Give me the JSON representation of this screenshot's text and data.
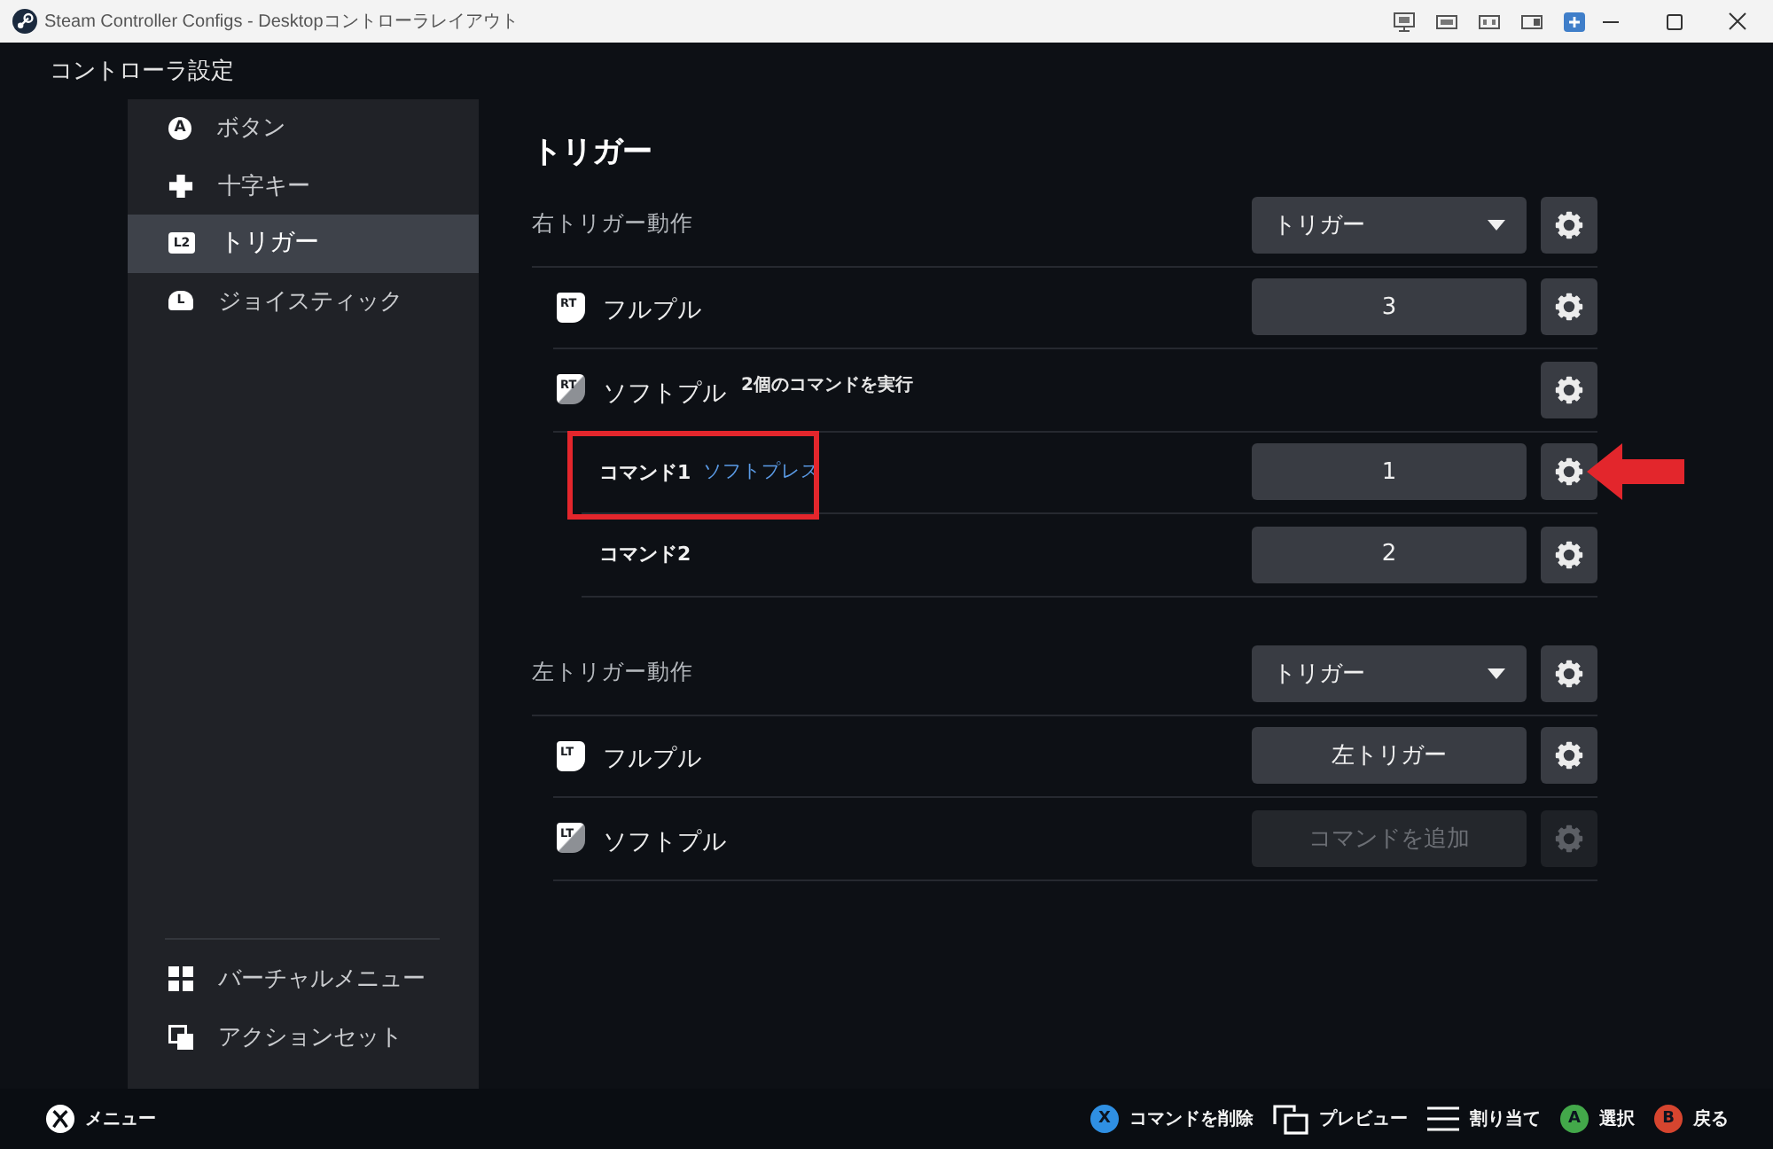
{
  "window": {
    "title": "Steam Controller Configs - Desktopコントローラレイアウト"
  },
  "header": {
    "title": "コントローラ設定"
  },
  "sidebar": {
    "items": [
      {
        "kind": "face-button",
        "badge": "A",
        "label": "ボタン",
        "selected": false
      },
      {
        "kind": "dpad",
        "label": "十字キー",
        "selected": false
      },
      {
        "kind": "trigger",
        "badge": "L2",
        "label": "トリガー",
        "selected": true
      },
      {
        "kind": "stick",
        "badge": "L",
        "label": "ジョイスティック",
        "selected": false
      }
    ],
    "footer_items": [
      {
        "kind": "grid",
        "label": "バーチャルメニュー",
        "selected": false
      },
      {
        "kind": "stack",
        "label": "アクションセット",
        "selected": false
      }
    ]
  },
  "page": {
    "title": "トリガー",
    "sections": [
      {
        "label": "右トリガー動作",
        "mode": "トリガー",
        "rows": [
          {
            "kind": "full-pull",
            "badge": "RT",
            "label": "フルプル",
            "binding": {
              "label": "3",
              "disabled": false
            },
            "settings_disabled": false
          },
          {
            "kind": "soft-pull",
            "badge": "RT",
            "label": "ソフトプル",
            "note": "2個のコマンドを実行",
            "settings_disabled": false,
            "commands": [
              {
                "name": "コマンド1",
                "action": "ソフトプレス",
                "binding": {
                  "label": "1",
                  "disabled": false
                },
                "settings_disabled": false,
                "highlighted": true,
                "arrow": true
              },
              {
                "name": "コマンド2",
                "binding": {
                  "label": "2",
                  "disabled": false
                },
                "settings_disabled": false,
                "highlighted": false,
                "arrow": false
              }
            ]
          }
        ]
      },
      {
        "label": "左トリガー動作",
        "mode": "トリガー",
        "rows": [
          {
            "kind": "full-pull",
            "badge": "LT",
            "label": "フルプル",
            "binding": {
              "label": "左トリガー",
              "disabled": false
            },
            "settings_disabled": false
          },
          {
            "kind": "soft-pull",
            "badge": "LT",
            "label": "ソフトプル",
            "binding": {
              "label": "コマンドを追加",
              "disabled": true
            },
            "settings_disabled": true
          }
        ]
      }
    ]
  },
  "bottom_bar": {
    "menu": "メニュー",
    "actions": [
      {
        "kind": "face-button",
        "key": "X",
        "color": "#2f8fe3",
        "label": "コマンドを削除"
      },
      {
        "kind": "preview",
        "label": "プレビュー"
      },
      {
        "kind": "lines",
        "label": "割り当て"
      },
      {
        "kind": "face-button",
        "key": "A",
        "color": "#43a84a",
        "label": "選択"
      },
      {
        "kind": "face-button",
        "key": "B",
        "color": "#d6452f",
        "label": "戻る"
      }
    ]
  }
}
